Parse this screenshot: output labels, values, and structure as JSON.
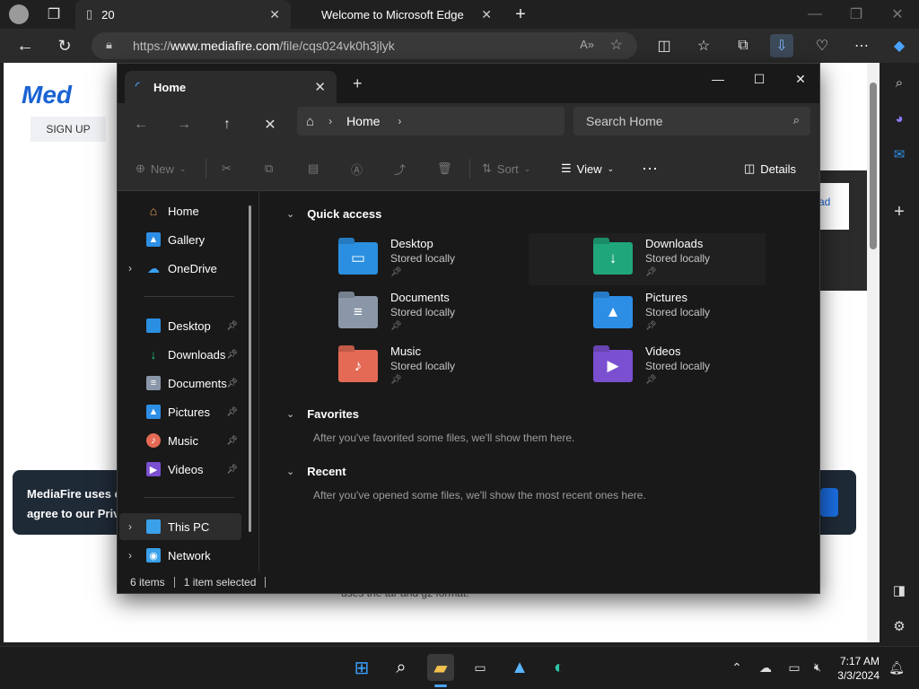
{
  "browser": {
    "tabs": [
      {
        "label": "20",
        "active": true
      },
      {
        "label": "Welcome to Microsoft Edge",
        "active": false
      }
    ],
    "url_prefix": "https://",
    "url_host": "www.mediafire.com",
    "url_path": "/file/cqs024vk0h3jlyk"
  },
  "page": {
    "logo_text": "Med",
    "signup_label": "SIGN UP",
    "cookie_line1": "MediaFire uses c",
    "cookie_line2": "agree to our Priva",
    "right_card_link": "ad",
    "bottom_text": "uses the tar and gz format."
  },
  "explorer": {
    "tab_title": "Home",
    "breadcrumb": "Home",
    "search_placeholder": "Search Home",
    "commands": {
      "new": "New",
      "sort": "Sort",
      "view": "View",
      "details": "Details"
    },
    "nav_pane": {
      "top": [
        {
          "label": "Home",
          "icon": "home-icon"
        },
        {
          "label": "Gallery",
          "icon": "gallery-icon"
        },
        {
          "label": "OneDrive",
          "icon": "onedrive-icon"
        }
      ],
      "pinned": [
        {
          "label": "Desktop",
          "icon": "desktop-folder-icon"
        },
        {
          "label": "Downloads",
          "icon": "downloads-folder-icon"
        },
        {
          "label": "Documents",
          "icon": "documents-folder-icon"
        },
        {
          "label": "Pictures",
          "icon": "pictures-folder-icon"
        },
        {
          "label": "Music",
          "icon": "music-folder-icon"
        },
        {
          "label": "Videos",
          "icon": "videos-folder-icon"
        }
      ],
      "bottom": [
        {
          "label": "This PC",
          "icon": "this-pc-icon"
        },
        {
          "label": "Network",
          "icon": "network-icon"
        }
      ]
    },
    "sections": {
      "quick_access": "Quick access",
      "favorites": "Favorites",
      "favorites_msg": "After you've favorited some files, we'll show them here.",
      "recent": "Recent",
      "recent_msg": "After you've opened some files, we'll show the most recent ones here."
    },
    "quick_access_items": [
      {
        "name": "Desktop",
        "sub": "Stored locally",
        "color": "#2a8fe0",
        "glyph": "▭"
      },
      {
        "name": "Downloads",
        "sub": "Stored locally",
        "color": "#1fa67a",
        "glyph": "↓"
      },
      {
        "name": "Documents",
        "sub": "Stored locally",
        "color": "#8a97a8",
        "glyph": "≡"
      },
      {
        "name": "Pictures",
        "sub": "Stored locally",
        "color": "#2d8ee6",
        "glyph": "▲"
      },
      {
        "name": "Music",
        "sub": "Stored locally",
        "color": "#e46a55",
        "glyph": "♪"
      },
      {
        "name": "Videos",
        "sub": "Stored locally",
        "color": "#7a4fd0",
        "glyph": "▶"
      }
    ],
    "status": {
      "items": "6 items",
      "selected": "1 item selected"
    }
  },
  "taskbar": {
    "time": "7:17 AM",
    "date": "3/3/2024"
  }
}
